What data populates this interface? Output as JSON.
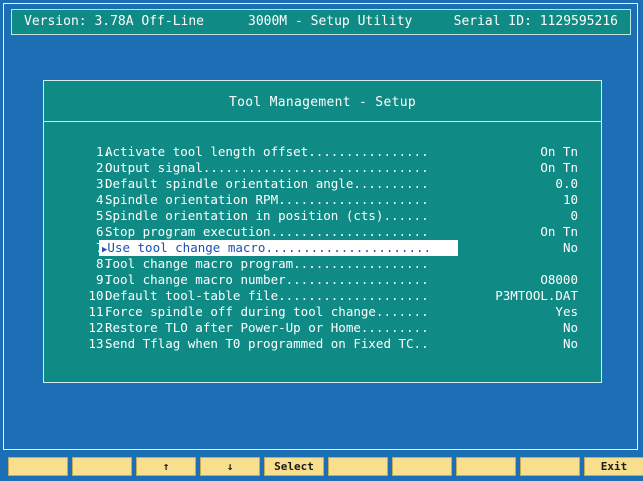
{
  "header": {
    "version": "Version: 3.78A Off-Line",
    "title": "3000M - Setup Utility",
    "serial": "Serial ID: 1129595216"
  },
  "panel": {
    "title": "Tool Management - Setup",
    "items": [
      {
        "num": "1.",
        "label": "Activate tool length offset................",
        "value": "On Tn"
      },
      {
        "num": "2.",
        "label": "Output signal..............................",
        "value": "On Tn"
      },
      {
        "num": "3.",
        "label": "Default spindle orientation angle..........",
        "value": "0.0"
      },
      {
        "num": "4.",
        "label": "Spindle orientation RPM....................",
        "value": "10"
      },
      {
        "num": "5.",
        "label": "Spindle orientation in position (cts)......",
        "value": "0"
      },
      {
        "num": "6.",
        "label": "Stop program execution.....................",
        "value": "On Tn"
      },
      {
        "num": "7.",
        "label": "Use tool change macro......................",
        "value": "No"
      },
      {
        "num": "8.",
        "label": "Tool change macro program..................",
        "value": ""
      },
      {
        "num": "9.",
        "label": "Tool change macro number...................",
        "value": "O8000"
      },
      {
        "num": "10.",
        "label": "Default tool-table file....................",
        "value": "P3MTOOL.DAT"
      },
      {
        "num": "11.",
        "label": "Force spindle off during tool change.......",
        "value": "Yes"
      },
      {
        "num": "12.",
        "label": "Restore TLO after Power-Up or Home.........",
        "value": "No"
      },
      {
        "num": "13.",
        "label": "Send Tflag when T0 programmed on Fixed TC..",
        "value": "No"
      }
    ],
    "selected_index": 6,
    "selected_marker": "▶"
  },
  "fkeys": [
    "",
    "",
    "↑",
    "↓",
    "Select",
    "",
    "",
    "",
    "",
    "Exit"
  ]
}
